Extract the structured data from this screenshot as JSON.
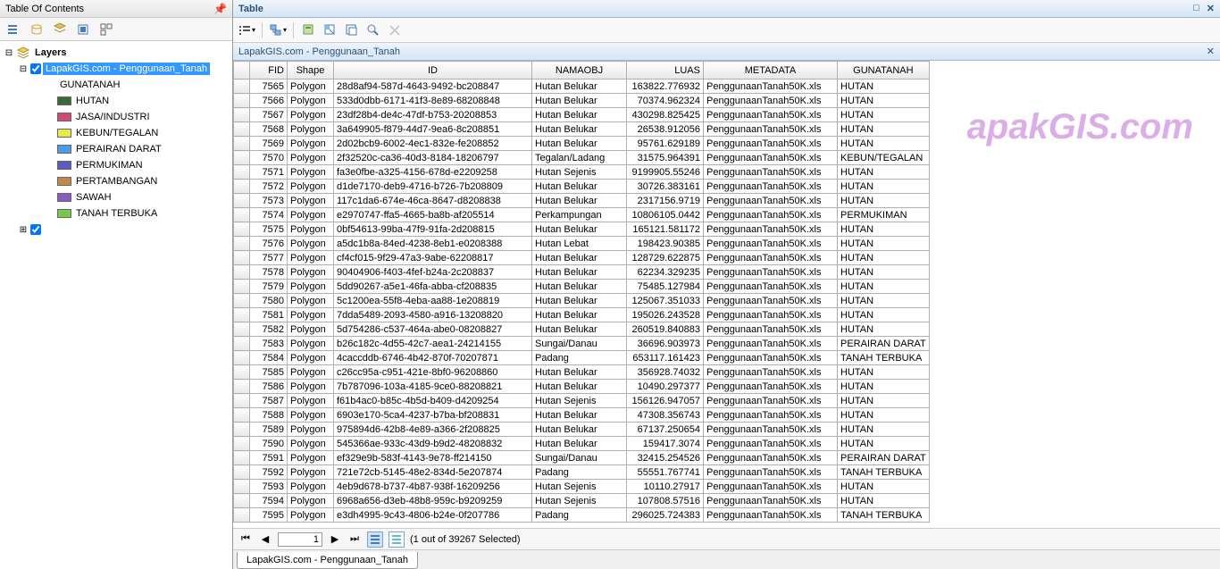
{
  "toc": {
    "title": "Table Of Contents",
    "root": "Layers",
    "layer_selected": "LapakGIS.com - Penggunaan_Tanah",
    "field": "GUNATANAH",
    "legend": [
      {
        "label": "HUTAN",
        "color": "#3a6b3a"
      },
      {
        "label": "JASA/INDUSTRI",
        "color": "#d04a7a"
      },
      {
        "label": "KEBUN/TEGALAN",
        "color": "#e8e84a"
      },
      {
        "label": "PERAIRAN DARAT",
        "color": "#4a9be8"
      },
      {
        "label": "PERMUKIMAN",
        "color": "#5a5ac0"
      },
      {
        "label": "PERTAMBANGAN",
        "color": "#c08a4a"
      },
      {
        "label": "SAWAH",
        "color": "#8a5ac0"
      },
      {
        "label": "TANAH TERBUKA",
        "color": "#7ac84a"
      }
    ]
  },
  "table": {
    "panel_title": "Table",
    "layer_title": "LapakGIS.com - Penggunaan_Tanah",
    "columns": [
      "FID",
      "Shape",
      "ID",
      "NAMAOBJ",
      "LUAS",
      "METADATA",
      "GUNATANAH"
    ],
    "rows": [
      {
        "fid": "7565",
        "shape": "Polygon",
        "id": "28d8af94-587d-4643-9492-bc208847",
        "nm": "Hutan Belukar",
        "luas": "163822.776932",
        "md": "PenggunaanTanah50K.xls",
        "gt": "HUTAN"
      },
      {
        "fid": "7566",
        "shape": "Polygon",
        "id": "533d0dbb-6171-41f3-8e89-68208848",
        "nm": "Hutan Belukar",
        "luas": "70374.962324",
        "md": "PenggunaanTanah50K.xls",
        "gt": "HUTAN"
      },
      {
        "fid": "7567",
        "shape": "Polygon",
        "id": "23df28b4-de4c-47df-b753-20208853",
        "nm": "Hutan Belukar",
        "luas": "430298.825425",
        "md": "PenggunaanTanah50K.xls",
        "gt": "HUTAN"
      },
      {
        "fid": "7568",
        "shape": "Polygon",
        "id": "3a649905-f879-44d7-9ea6-8c208851",
        "nm": "Hutan Belukar",
        "luas": "26538.912056",
        "md": "PenggunaanTanah50K.xls",
        "gt": "HUTAN"
      },
      {
        "fid": "7569",
        "shape": "Polygon",
        "id": "2d02bcb9-6002-4ec1-832e-fe208852",
        "nm": "Hutan Belukar",
        "luas": "95761.629189",
        "md": "PenggunaanTanah50K.xls",
        "gt": "HUTAN"
      },
      {
        "fid": "7570",
        "shape": "Polygon",
        "id": "2f32520c-ca36-40d3-8184-18206797",
        "nm": "Tegalan/Ladang",
        "luas": "31575.964391",
        "md": "PenggunaanTanah50K.xls",
        "gt": "KEBUN/TEGALAN"
      },
      {
        "fid": "7571",
        "shape": "Polygon",
        "id": "fa3e0fbe-a325-4156-678d-e2209258",
        "nm": "Hutan Sejenis",
        "luas": "9199905.55246",
        "md": "PenggunaanTanah50K.xls",
        "gt": "HUTAN"
      },
      {
        "fid": "7572",
        "shape": "Polygon",
        "id": "d1de7170-deb9-4716-b726-7b208809",
        "nm": "Hutan Belukar",
        "luas": "30726.383161",
        "md": "PenggunaanTanah50K.xls",
        "gt": "HUTAN"
      },
      {
        "fid": "7573",
        "shape": "Polygon",
        "id": "117c1da6-674e-46ca-8647-d8208838",
        "nm": "Hutan Belukar",
        "luas": "2317156.9719",
        "md": "PenggunaanTanah50K.xls",
        "gt": "HUTAN"
      },
      {
        "fid": "7574",
        "shape": "Polygon",
        "id": "e2970747-ffa5-4665-ba8b-af205514",
        "nm": "Perkampungan",
        "luas": "10806105.0442",
        "md": "PenggunaanTanah50K.xls",
        "gt": "PERMUKIMAN"
      },
      {
        "fid": "7575",
        "shape": "Polygon",
        "id": "0bf54613-99ba-47f9-91fa-2d208815",
        "nm": "Hutan Belukar",
        "luas": "165121.581172",
        "md": "PenggunaanTanah50K.xls",
        "gt": "HUTAN"
      },
      {
        "fid": "7576",
        "shape": "Polygon",
        "id": "a5dc1b8a-84ed-4238-8eb1-e0208388",
        "nm": "Hutan Lebat",
        "luas": "198423.90385",
        "md": "PenggunaanTanah50K.xls",
        "gt": "HUTAN"
      },
      {
        "fid": "7577",
        "shape": "Polygon",
        "id": "cf4cf015-9f29-47a3-9abe-62208817",
        "nm": "Hutan Belukar",
        "luas": "128729.622875",
        "md": "PenggunaanTanah50K.xls",
        "gt": "HUTAN"
      },
      {
        "fid": "7578",
        "shape": "Polygon",
        "id": "90404906-f403-4fef-b24a-2c208837",
        "nm": "Hutan Belukar",
        "luas": "62234.329235",
        "md": "PenggunaanTanah50K.xls",
        "gt": "HUTAN"
      },
      {
        "fid": "7579",
        "shape": "Polygon",
        "id": "5dd90267-a5e1-46fa-abba-cf208835",
        "nm": "Hutan Belukar",
        "luas": "75485.127984",
        "md": "PenggunaanTanah50K.xls",
        "gt": "HUTAN"
      },
      {
        "fid": "7580",
        "shape": "Polygon",
        "id": "5c1200ea-55f8-4eba-aa88-1e208819",
        "nm": "Hutan Belukar",
        "luas": "125067.351033",
        "md": "PenggunaanTanah50K.xls",
        "gt": "HUTAN"
      },
      {
        "fid": "7581",
        "shape": "Polygon",
        "id": "7dda5489-2093-4580-a916-13208820",
        "nm": "Hutan Belukar",
        "luas": "195026.243528",
        "md": "PenggunaanTanah50K.xls",
        "gt": "HUTAN"
      },
      {
        "fid": "7582",
        "shape": "Polygon",
        "id": "5d754286-c537-464a-abe0-08208827",
        "nm": "Hutan Belukar",
        "luas": "260519.840883",
        "md": "PenggunaanTanah50K.xls",
        "gt": "HUTAN"
      },
      {
        "fid": "7583",
        "shape": "Polygon",
        "id": "b26c182c-4d55-42c7-aea1-24214155",
        "nm": "Sungai/Danau",
        "luas": "36696.903973",
        "md": "PenggunaanTanah50K.xls",
        "gt": "PERAIRAN DARAT"
      },
      {
        "fid": "7584",
        "shape": "Polygon",
        "id": "4caccddb-6746-4b42-870f-70207871",
        "nm": "Padang",
        "luas": "653117.161423",
        "md": "PenggunaanTanah50K.xls",
        "gt": "TANAH TERBUKA"
      },
      {
        "fid": "7585",
        "shape": "Polygon",
        "id": "c26cc95a-c951-421e-8bf0-96208860",
        "nm": "Hutan Belukar",
        "luas": "356928.74032",
        "md": "PenggunaanTanah50K.xls",
        "gt": "HUTAN"
      },
      {
        "fid": "7586",
        "shape": "Polygon",
        "id": "7b787096-103a-4185-9ce0-88208821",
        "nm": "Hutan Belukar",
        "luas": "10490.297377",
        "md": "PenggunaanTanah50K.xls",
        "gt": "HUTAN"
      },
      {
        "fid": "7587",
        "shape": "Polygon",
        "id": "f61b4ac0-b85c-4b5d-b409-d4209254",
        "nm": "Hutan Sejenis",
        "luas": "156126.947057",
        "md": "PenggunaanTanah50K.xls",
        "gt": "HUTAN"
      },
      {
        "fid": "7588",
        "shape": "Polygon",
        "id": "6903e170-5ca4-4237-b7ba-bf208831",
        "nm": "Hutan Belukar",
        "luas": "47308.356743",
        "md": "PenggunaanTanah50K.xls",
        "gt": "HUTAN"
      },
      {
        "fid": "7589",
        "shape": "Polygon",
        "id": "975894d6-42b8-4e89-a366-2f208825",
        "nm": "Hutan Belukar",
        "luas": "67137.250654",
        "md": "PenggunaanTanah50K.xls",
        "gt": "HUTAN"
      },
      {
        "fid": "7590",
        "shape": "Polygon",
        "id": "545366ae-933c-43d9-b9d2-48208832",
        "nm": "Hutan Belukar",
        "luas": "159417.3074",
        "md": "PenggunaanTanah50K.xls",
        "gt": "HUTAN"
      },
      {
        "fid": "7591",
        "shape": "Polygon",
        "id": "ef329e9b-583f-4143-9e78-ff214150",
        "nm": "Sungai/Danau",
        "luas": "32415.254526",
        "md": "PenggunaanTanah50K.xls",
        "gt": "PERAIRAN DARAT"
      },
      {
        "fid": "7592",
        "shape": "Polygon",
        "id": "721e72cb-5145-48e2-834d-5e207874",
        "nm": "Padang",
        "luas": "55551.767741",
        "md": "PenggunaanTanah50K.xls",
        "gt": "TANAH TERBUKA"
      },
      {
        "fid": "7593",
        "shape": "Polygon",
        "id": "4eb9d678-b737-4b87-938f-16209256",
        "nm": "Hutan Sejenis",
        "luas": "10110.27917",
        "md": "PenggunaanTanah50K.xls",
        "gt": "HUTAN"
      },
      {
        "fid": "7594",
        "shape": "Polygon",
        "id": "6968a656-d3eb-48b8-959c-b9209259",
        "nm": "Hutan Sejenis",
        "luas": "107808.57516",
        "md": "PenggunaanTanah50K.xls",
        "gt": "HUTAN"
      },
      {
        "fid": "7595",
        "shape": "Polygon",
        "id": "e3dh4995-9c43-4806-b24e-0f207786",
        "nm": "Padang",
        "luas": "296025.724383",
        "md": "PenggunaanTanah50K.xls",
        "gt": "TANAH TERBUKA"
      }
    ],
    "nav": {
      "current": "1",
      "status": "(1 out of 39267 Selected)"
    },
    "tab": "LapakGIS.com - Penggunaan_Tanah"
  },
  "watermark": "apakGIS.com"
}
